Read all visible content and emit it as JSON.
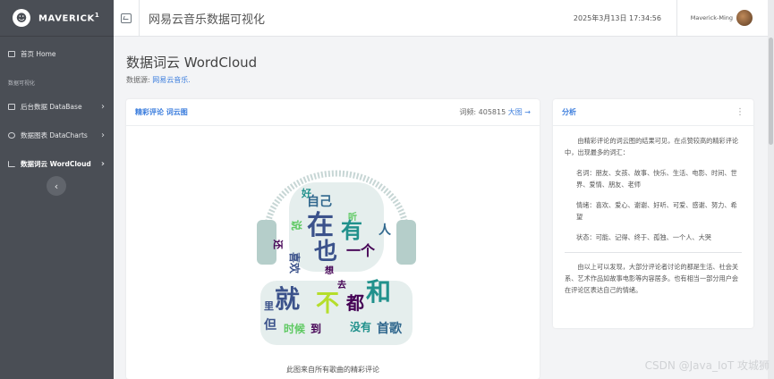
{
  "brand": {
    "name": "MAVERICK",
    "sup": "1"
  },
  "sidebar": {
    "home": "首页 Home",
    "section": "数据可视化",
    "items": [
      {
        "label": "后台数据 DataBase"
      },
      {
        "label": "数据图表 DataCharts"
      },
      {
        "label": "数据词云 WordCloud"
      }
    ]
  },
  "header": {
    "title": "网易云音乐数据可视化",
    "datetime": "2025年3月13日 17:34:56",
    "user": "Maverick-Ming"
  },
  "page": {
    "title": "数据词云 WordCloud",
    "source_label": "数据源:",
    "source_link": "网易云音乐."
  },
  "wordcloud_card": {
    "title": "精彩评论 词云图",
    "freq_label": "词频:",
    "freq_value": "405815",
    "big_link": "大图 →",
    "caption": "此图来自所有歌曲的精彩评论"
  },
  "analysis_card": {
    "title": "分析",
    "intro": "由精彩评论的词云图的结果可见，在点赞较高的精彩评论中，出现最多的词汇：",
    "nouns": "名词：朋友、女孩、故事、快乐、生活、电影、时间、世界、爱情、朋友、老师",
    "emotions": "情绪：喜欢、爱心、谢谢、好听、可爱、感谢、努力、希望",
    "states": "状态：可能、记得、终于、孤独、一个人、大哭",
    "conclusion": "由以上可以发现，大部分评论者讨论的都是生活、社会关系、艺术作品如故事电影等内容居多。也有相当一部分用户会在评论区表达自己的情绪。"
  },
  "wordcloud_words": [
    {
      "t": "在",
      "c": "#3b528b"
    },
    {
      "t": "有",
      "c": "#21918c"
    },
    {
      "t": "也",
      "c": "#3b528b"
    },
    {
      "t": "一个",
      "c": "#440154"
    },
    {
      "t": "自己",
      "c": "#31688e"
    },
    {
      "t": "说",
      "c": "#5ec962"
    },
    {
      "t": "人",
      "c": "#31688e"
    },
    {
      "t": "还",
      "c": "#440154"
    },
    {
      "t": "好",
      "c": "#21918c"
    },
    {
      "t": "喜欢",
      "c": "#3b528b"
    },
    {
      "t": "想",
      "c": "#440154"
    },
    {
      "t": "听",
      "c": "#5ec962"
    },
    {
      "t": "就",
      "c": "#3b528b"
    },
    {
      "t": "不",
      "c": "#b5de2b"
    },
    {
      "t": "都",
      "c": "#440154"
    },
    {
      "t": "和",
      "c": "#21918c"
    },
    {
      "t": "但",
      "c": "#3b528b"
    },
    {
      "t": "时候",
      "c": "#5ec962"
    },
    {
      "t": "到",
      "c": "#440154"
    },
    {
      "t": "没有",
      "c": "#21918c"
    },
    {
      "t": "首歌",
      "c": "#31688e"
    },
    {
      "t": "去",
      "c": "#440154"
    },
    {
      "t": "里",
      "c": "#3b528b"
    }
  ],
  "colors": {
    "accent": "#3b7ddd",
    "sidebar": "#4a4e55"
  }
}
